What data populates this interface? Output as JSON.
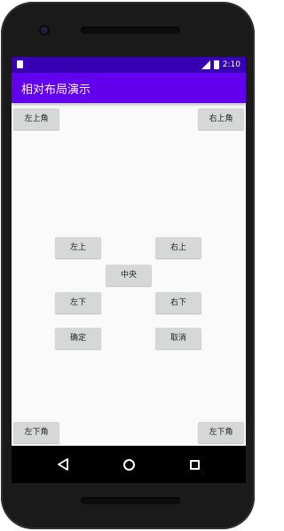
{
  "status_bar": {
    "time": "2:10",
    "network_badge": "LTE"
  },
  "app_bar": {
    "title": "相对布局演示"
  },
  "buttons": {
    "top_left_corner": "左上角",
    "top_right_corner": "右上角",
    "upper_left": "左上",
    "upper_right": "右上",
    "center": "中央",
    "lower_left": "左下",
    "lower_right": "右下",
    "confirm": "确定",
    "cancel": "取消",
    "bottom_left_corner": "左下角",
    "bottom_right_corner": "左下角"
  },
  "colors": {
    "status_bar": "#3700b3",
    "app_bar": "#6200ee",
    "button": "#d6d7d7",
    "background": "#fafafa"
  }
}
